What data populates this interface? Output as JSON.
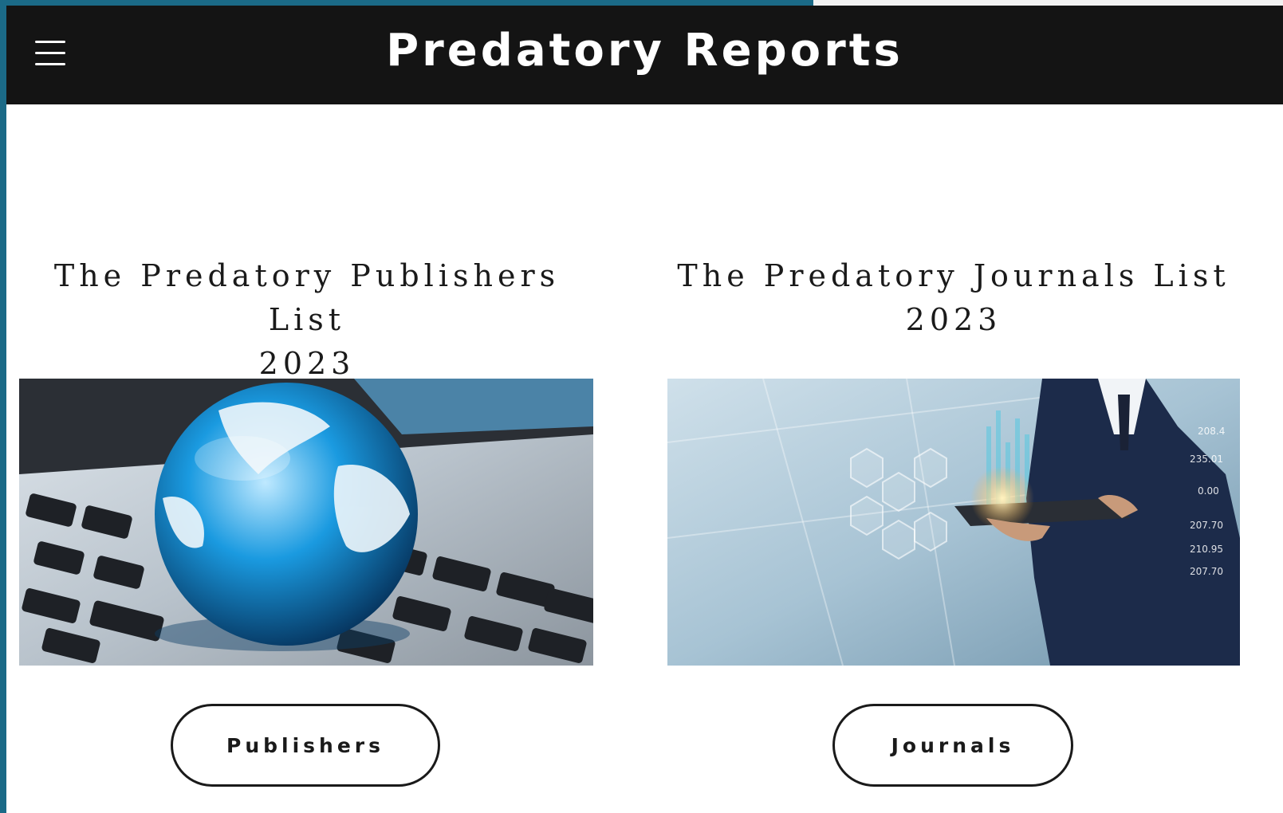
{
  "header": {
    "site_title": "Predatory Reports"
  },
  "cards": [
    {
      "title_line1": "The Predatory Publishers List",
      "title_line2": "2023",
      "image_icon": "globe-on-laptop-keyboard-photo",
      "button_label": "Publishers"
    },
    {
      "title_line1": "The Predatory Journals List",
      "title_line2": "2023",
      "image_icon": "businessman-with-tablet-data-photo",
      "button_label": "Journals"
    }
  ],
  "colors": {
    "header_bg": "#141414",
    "backdrop": "#1b6a87",
    "text": "#1a1a1a"
  }
}
